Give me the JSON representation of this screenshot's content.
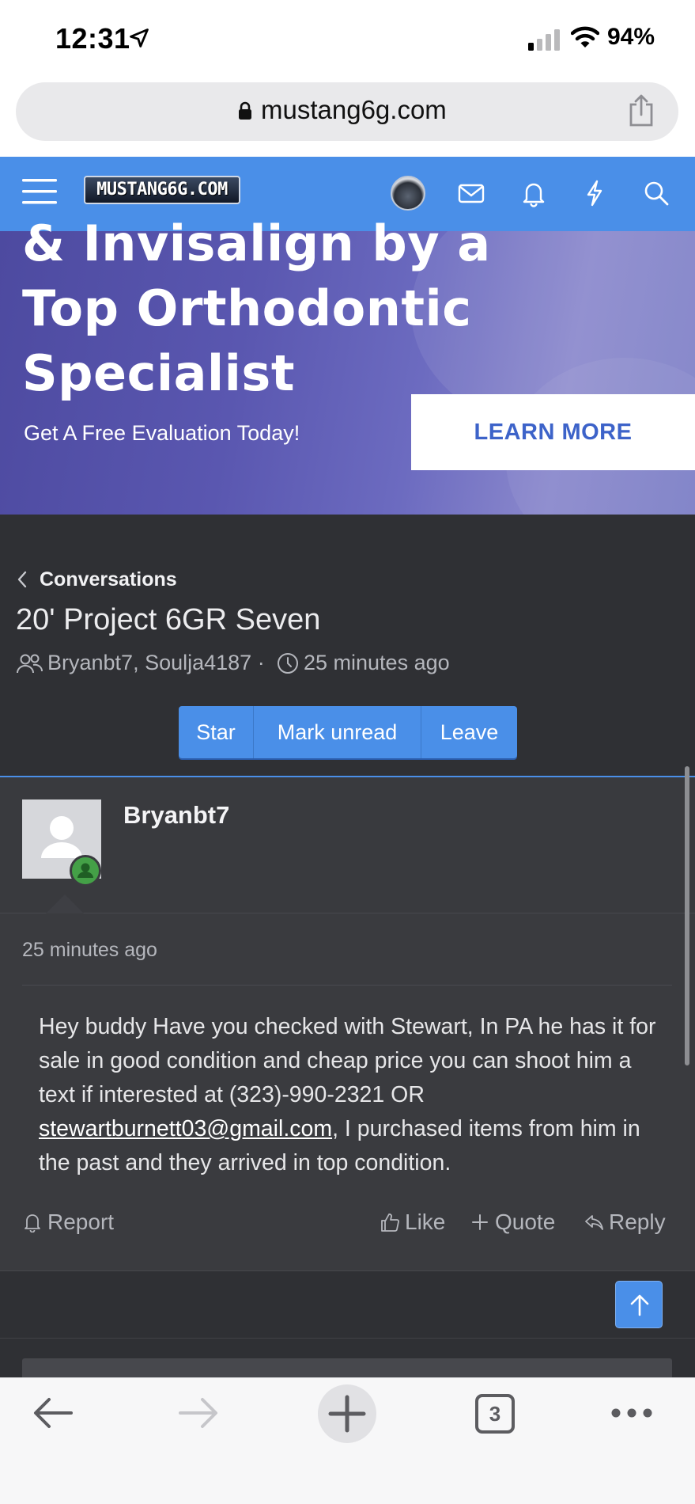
{
  "status_bar": {
    "time": "12:31",
    "battery": "94%"
  },
  "browser": {
    "url": "mustang6g.com",
    "tab_count": "3"
  },
  "site": {
    "logo_text": "MUSTANG6G.COM"
  },
  "ad": {
    "line1": "& Invisalign by a",
    "line2": "Top Orthodontic",
    "line3": "Specialist",
    "subtext": "Get A Free Evaluation Today!",
    "cta": "LEARN MORE"
  },
  "conversation": {
    "breadcrumb": "Conversations",
    "title": "20' Project 6GR Seven",
    "participants": "Bryanbt7, Soulja4187 ·",
    "time": "25 minutes ago",
    "buttons": {
      "star": "Star",
      "mark_unread": "Mark unread",
      "leave": "Leave"
    }
  },
  "message": {
    "author": "Bryanbt7",
    "time": "25 minutes ago",
    "body_before": "Hey buddy Have you checked with Stewart, In PA he has it for sale in good condition and cheap price you can shoot him a text if interested at (323)-990-2321 OR ",
    "email": "stewartburnett03@gmail.com",
    "body_after": ", I purchased items from him in the past and they arrived in top condition.",
    "actions": {
      "report": "Report",
      "like": "Like",
      "quote": "Quote",
      "reply": "Reply"
    }
  }
}
